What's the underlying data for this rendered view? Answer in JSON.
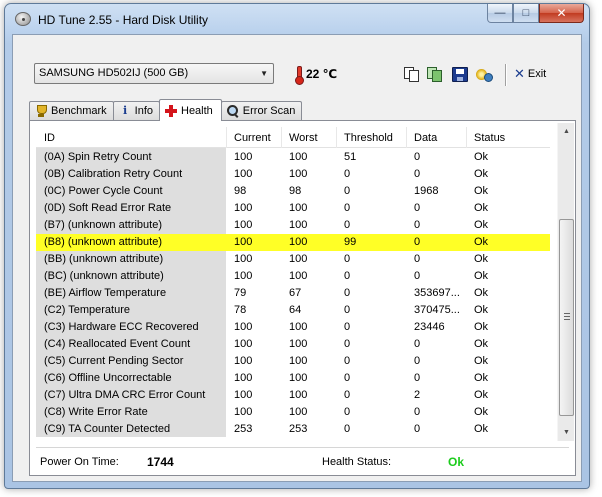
{
  "window": {
    "title": "HD Tune 2.55 - Hard Disk Utility",
    "min_glyph": "—",
    "max_glyph": "□",
    "close_glyph": "✕"
  },
  "toolbar": {
    "drive": "SAMSUNG HD502IJ (500 GB)",
    "dropdown_glyph": "▼",
    "temperature": "22 ℃",
    "exit_label": "Exit",
    "exit_glyph": "✕"
  },
  "tabs": [
    {
      "label": "Benchmark",
      "icon": "trophy-icon"
    },
    {
      "label": "Info",
      "icon": "info-icon"
    },
    {
      "label": "Health",
      "icon": "health-icon",
      "active": true
    },
    {
      "label": "Error Scan",
      "icon": "scan-icon"
    }
  ],
  "table": {
    "columns": [
      "ID",
      "Current",
      "Worst",
      "Threshold",
      "Data",
      "Status"
    ],
    "rows": [
      [
        "(0A) Spin Retry Count",
        "100",
        "100",
        "51",
        "0",
        "Ok"
      ],
      [
        "(0B) Calibration Retry Count",
        "100",
        "100",
        "0",
        "0",
        "Ok"
      ],
      [
        "(0C) Power Cycle Count",
        "98",
        "98",
        "0",
        "1968",
        "Ok"
      ],
      [
        "(0D) Soft Read Error Rate",
        "100",
        "100",
        "0",
        "0",
        "Ok"
      ],
      [
        "(B7) (unknown attribute)",
        "100",
        "100",
        "0",
        "0",
        "Ok"
      ],
      [
        "(B8) (unknown attribute)",
        "100",
        "100",
        "99",
        "0",
        "Ok"
      ],
      [
        "(BB) (unknown attribute)",
        "100",
        "100",
        "0",
        "0",
        "Ok"
      ],
      [
        "(BC) (unknown attribute)",
        "100",
        "100",
        "0",
        "0",
        "Ok"
      ],
      [
        "(BE) Airflow Temperature",
        "79",
        "67",
        "0",
        "353697...",
        "Ok"
      ],
      [
        "(C2) Temperature",
        "78",
        "64",
        "0",
        "370475...",
        "Ok"
      ],
      [
        "(C3) Hardware ECC Recovered",
        "100",
        "100",
        "0",
        "23446",
        "Ok"
      ],
      [
        "(C4) Reallocated Event Count",
        "100",
        "100",
        "0",
        "0",
        "Ok"
      ],
      [
        "(C5) Current Pending Sector",
        "100",
        "100",
        "0",
        "0",
        "Ok"
      ],
      [
        "(C6) Offline Uncorrectable",
        "100",
        "100",
        "0",
        "0",
        "Ok"
      ],
      [
        "(C7) Ultra DMA CRC Error Count",
        "100",
        "100",
        "0",
        "2",
        "Ok"
      ],
      [
        "(C8) Write Error Rate",
        "100",
        "100",
        "0",
        "0",
        "Ok"
      ],
      [
        "(C9) TA Counter Detected",
        "253",
        "253",
        "0",
        "0",
        "Ok"
      ]
    ],
    "highlighted_row": 5,
    "highlight_color": "#ffff26"
  },
  "scrollbar": {
    "up_glyph": "▲",
    "down_glyph": "▼"
  },
  "footer": {
    "power_on_label": "Power On Time:",
    "power_on_value": "1744",
    "health_label": "Health Status:",
    "health_value": "Ok",
    "health_color": "#1ccc1c"
  }
}
